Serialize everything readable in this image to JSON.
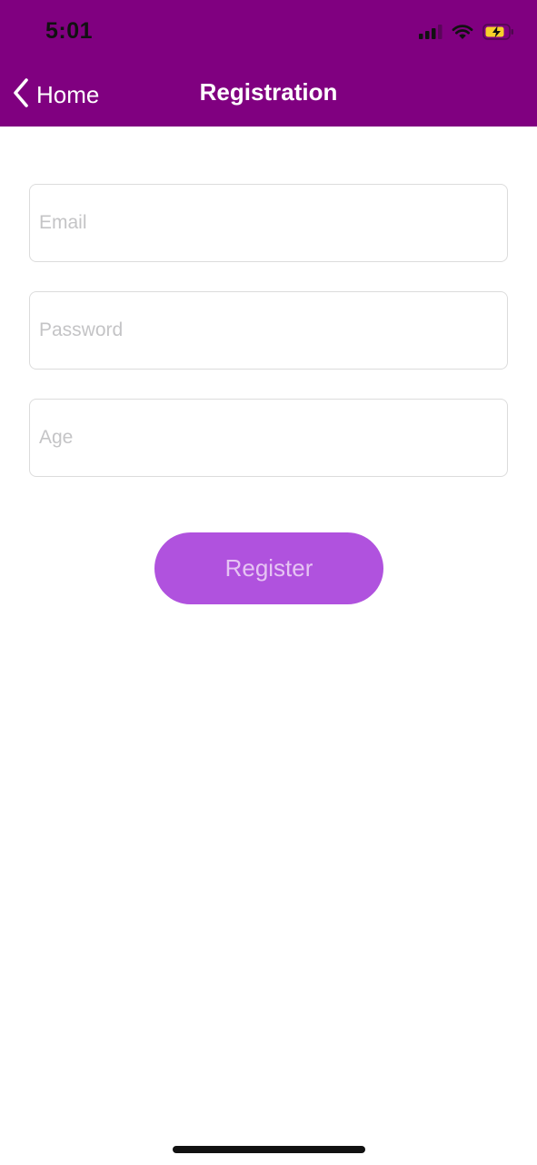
{
  "status_bar": {
    "time": "5:01"
  },
  "nav": {
    "back_label": "Home",
    "title": "Registration"
  },
  "form": {
    "email_placeholder": "Email",
    "password_placeholder": "Password",
    "age_placeholder": "Age",
    "email_value": "",
    "password_value": "",
    "age_value": "",
    "submit_label": "Register"
  },
  "colors": {
    "header_bg": "#800080",
    "button_bg": "#b052de",
    "button_text": "#e6c4f3",
    "battery_fill": "#f7d02a"
  },
  "icons": [
    "cellular-signal-icon",
    "wifi-icon",
    "battery-charging-icon",
    "chevron-left-icon"
  ]
}
